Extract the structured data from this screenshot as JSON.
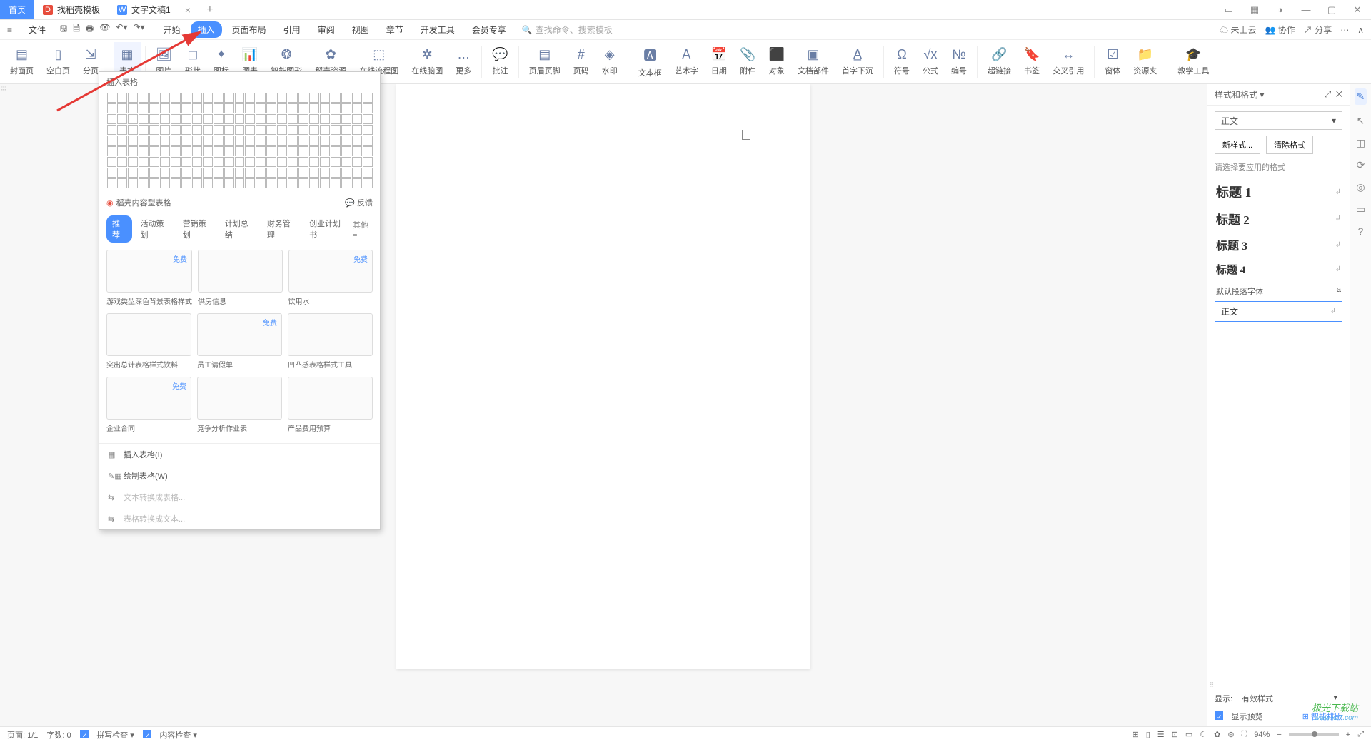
{
  "tabs": {
    "home": "首页",
    "template": "找稻壳模板",
    "doc": "文字文稿1"
  },
  "file_menu": "文件",
  "ribbon_tabs": [
    "开始",
    "插入",
    "页面布局",
    "引用",
    "审阅",
    "视图",
    "章节",
    "开发工具",
    "会员专享"
  ],
  "active_ribbon": "插入",
  "search_placeholder": "查找命令、搜索模板",
  "cloud": "未上云",
  "coop": "协作",
  "share": "分享",
  "ribbon": {
    "cover": "封面页",
    "blank": "空白页",
    "page_break": "分页",
    "table": "表格",
    "pic": "图片",
    "shape": "形状",
    "icon": "图标",
    "chart": "图表",
    "smart": "智能图形",
    "res": "稻壳资源",
    "flow": "在线流程图",
    "mind": "在线脑图",
    "more": "更多",
    "comment": "批注",
    "header": "页眉页脚",
    "pagenum": "页码",
    "watermark": "水印",
    "textbox": "文本框",
    "wordart": "艺术字",
    "date": "日期",
    "attach": "附件",
    "object": "对象",
    "docpart": "文档部件",
    "dropcap": "首字下沉",
    "symbol": "符号",
    "formula": "公式",
    "number": "编号",
    "link": "超链接",
    "bookmark": "书签",
    "xref": "交叉引用",
    "form": "窗体",
    "ressrc": "资源夹",
    "teach": "教学工具"
  },
  "dropdown": {
    "title": "插入表格",
    "dk_label": "稻壳内容型表格",
    "feedback": "反馈",
    "cats": [
      "推荐",
      "活动策划",
      "营销策划",
      "计划总结",
      "财务管理",
      "创业计划书"
    ],
    "other": "其他",
    "free": "免费",
    "tpl": [
      {
        "cap": "游戏类型深色背景表格样式",
        "free": true
      },
      {
        "cap": "供房信息",
        "free": false
      },
      {
        "cap": "饮用水",
        "free": true
      },
      {
        "cap": "突出总计表格样式饮料",
        "free": false
      },
      {
        "cap": "员工请假单",
        "free": true
      },
      {
        "cap": "凹凸感表格样式工具",
        "free": false
      },
      {
        "cap": "企业合同",
        "free": true
      },
      {
        "cap": "竞争分析作业表",
        "free": false
      },
      {
        "cap": "产品费用预算",
        "free": false
      }
    ],
    "insert": "插入表格(I)",
    "draw": "绘制表格(W)",
    "t2t": "文本转换成表格...",
    "t2x": "表格转换成文本..."
  },
  "side": {
    "title": "样式和格式",
    "current": "正文",
    "new": "新样式...",
    "clear": "清除格式",
    "hint": "请选择要应用的格式",
    "styles": [
      "标题 1",
      "标题 2",
      "标题 3",
      "标题 4"
    ],
    "def": "默认段落字体",
    "body": "正文",
    "show": "显示:",
    "show_val": "有效样式",
    "preview": "显示预览",
    "smart": "智能排版"
  },
  "status": {
    "page": "页面: 1/1",
    "words": "字数: 0",
    "spell": "拼写检查",
    "content": "内容检查",
    "zoom": "94%"
  },
  "watermark": {
    "l1": "极光下载站",
    "l2": "www.xz7.com"
  }
}
